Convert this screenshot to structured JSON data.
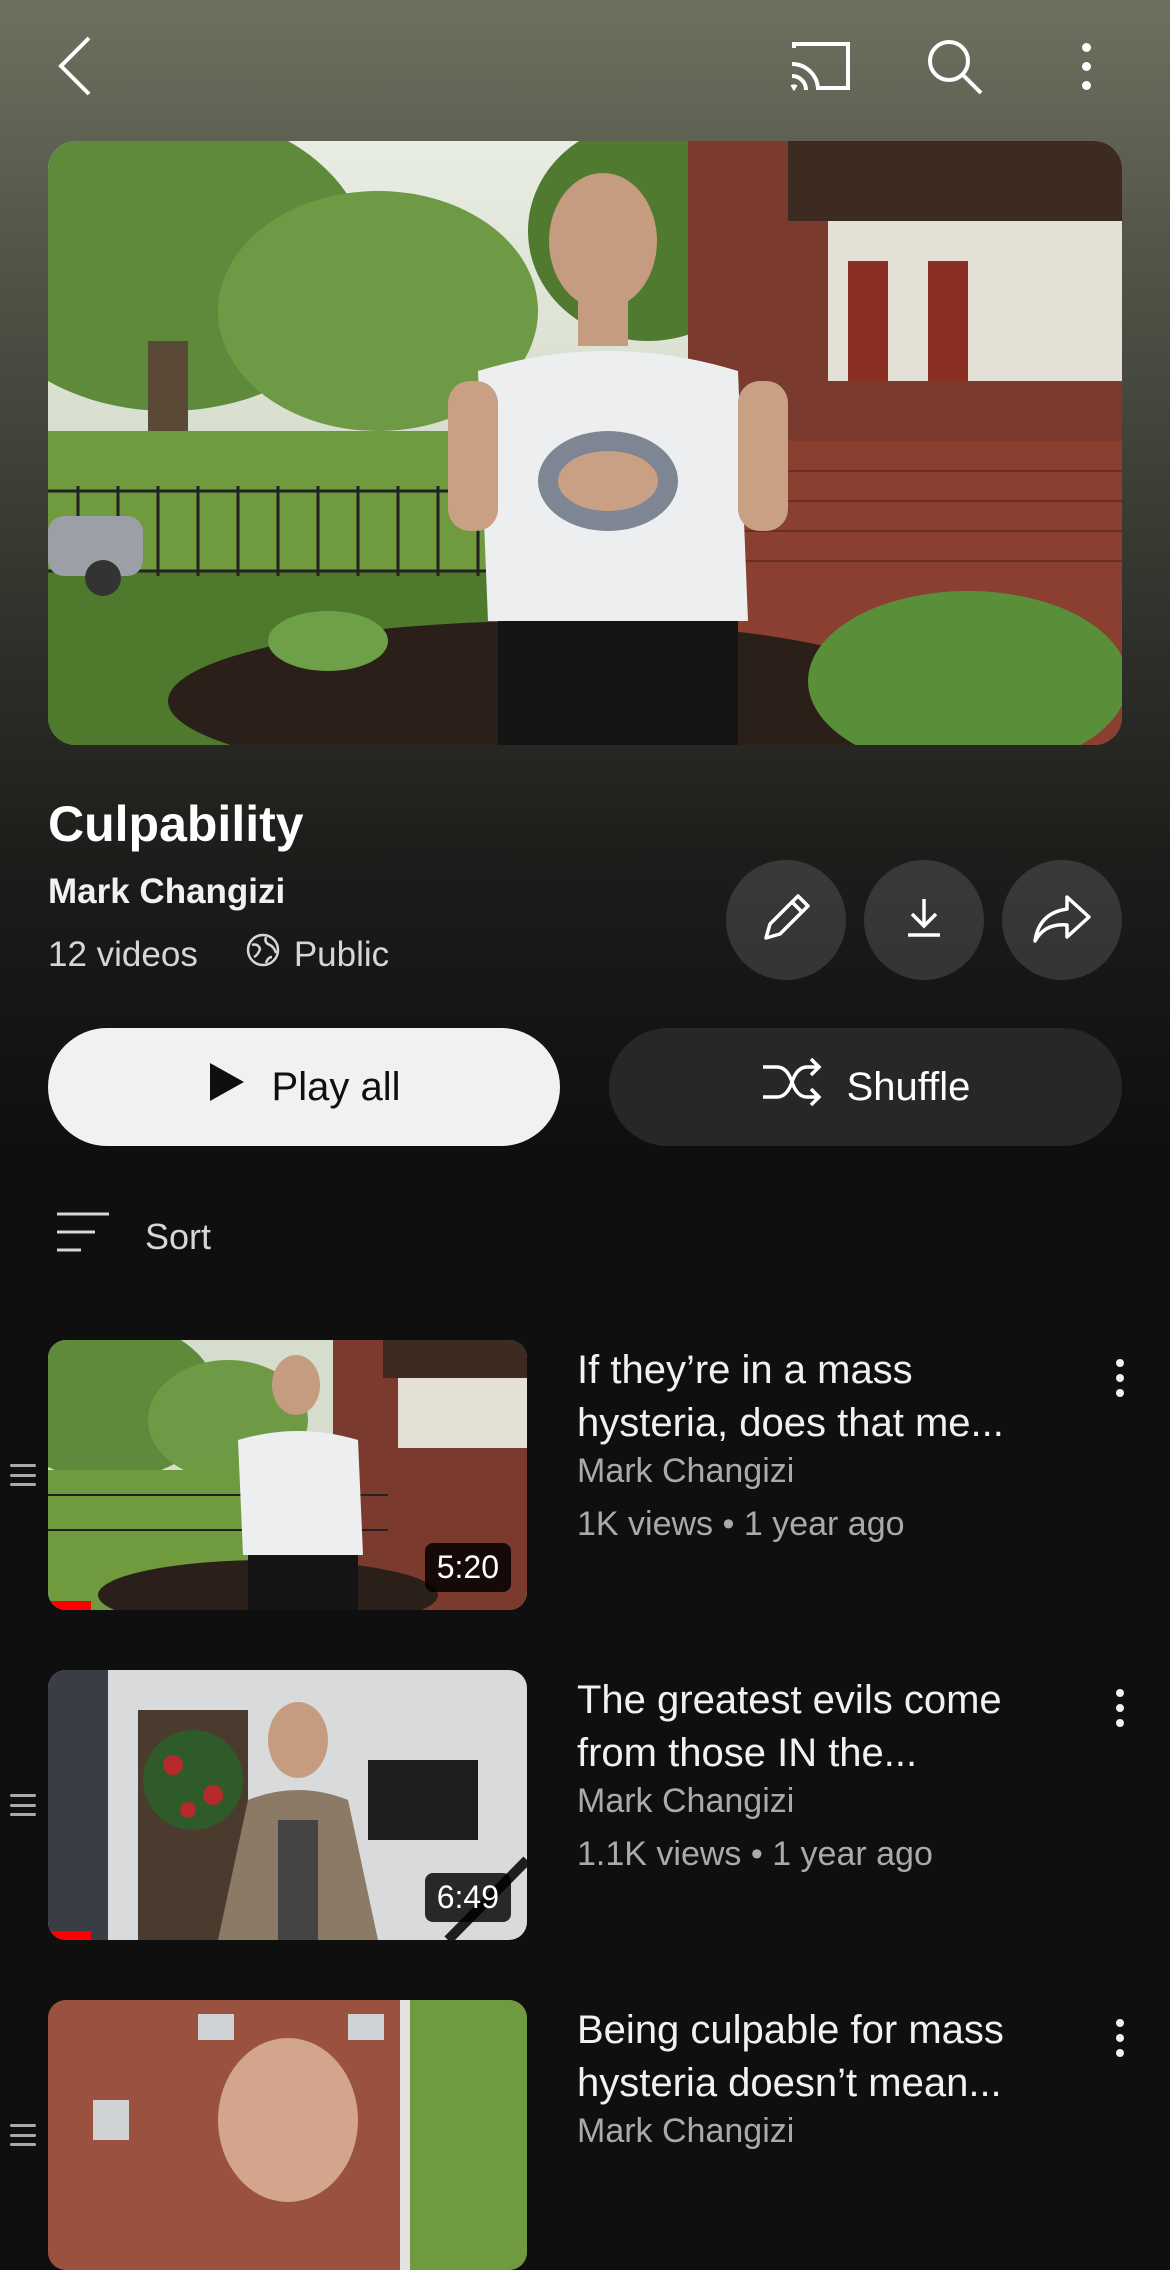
{
  "header": {
    "back_icon": "chevron-left-icon",
    "cast_icon": "cast-icon",
    "search_icon": "search-icon",
    "more_icon": "more-vertical-icon"
  },
  "playlist": {
    "title": "Culpability",
    "channel": "Mark Changizi",
    "video_count": "12 videos",
    "visibility": "Public",
    "actions": {
      "edit_icon": "pencil-icon",
      "download_icon": "download-icon",
      "share_icon": "share-icon"
    },
    "play_all_label": "Play all",
    "shuffle_label": "Shuffle"
  },
  "sort": {
    "label": "Sort"
  },
  "videos": [
    {
      "title": "If they’re in a mass hysteria, does that me...",
      "channel": "Mark Changizi",
      "stats": "1K views • 1 year ago",
      "duration": "5:20",
      "watched_fraction": 0.09
    },
    {
      "title": "The greatest evils come from those IN the...",
      "channel": "Mark Changizi",
      "stats": "1.1K views • 1 year ago",
      "duration": "6:49",
      "watched_fraction": 0.09
    },
    {
      "title": "Being culpable for mass hysteria doesn’t mean...",
      "channel": "Mark Changizi",
      "stats": "",
      "duration": "",
      "watched_fraction": 0
    }
  ],
  "colors": {
    "accent": "#ff0000",
    "background": "#0f0f0f",
    "primary_button": "#f1f1f1",
    "secondary_button": "#272727"
  }
}
